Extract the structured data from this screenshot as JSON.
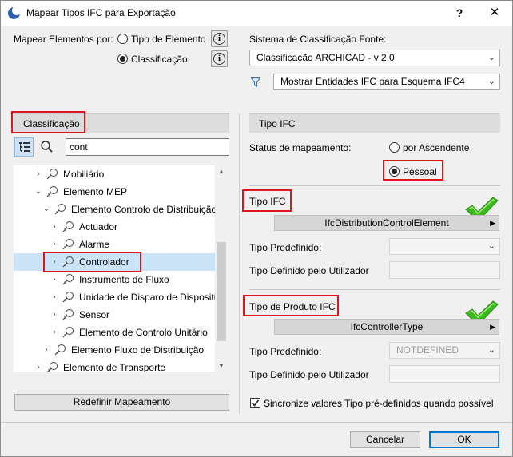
{
  "window": {
    "title": "Mapear Tipos IFC para Exportação",
    "help_label": "?",
    "close_label": "✕"
  },
  "map_by": {
    "label": "Mapear Elementos por:",
    "option_element_type": "Tipo de Elemento",
    "option_classification": "Classificação",
    "selected": "Classificação"
  },
  "source_system": {
    "label": "Sistema de Classificação Fonte:",
    "value": "Classificação ARCHICAD - v 2.0"
  },
  "filter": {
    "icon": "filter-icon",
    "value": "Mostrar Entidades IFC para Esquema IFC4"
  },
  "left_panel": {
    "header": "Classificação",
    "search_value": "cont",
    "tree": [
      {
        "label": "Mobiliário",
        "expander": "›"
      },
      {
        "label": "Elemento MEP",
        "expander": "⌄"
      },
      {
        "label": "Elemento Controlo de Distribuição",
        "expander": "⌄"
      },
      {
        "label": "Actuador",
        "expander": "›"
      },
      {
        "label": "Alarme",
        "expander": "›"
      },
      {
        "label": "Controlador",
        "expander": "›"
      },
      {
        "label": "Instrumento de Fluxo",
        "expander": "›"
      },
      {
        "label": "Unidade de Disparo de Dispositivo",
        "expander": "›"
      },
      {
        "label": "Sensor",
        "expander": "›"
      },
      {
        "label": "Elemento de Controlo Unitário",
        "expander": "›"
      },
      {
        "label": "Elemento Fluxo de Distribuição",
        "expander": "›"
      },
      {
        "label": "Elemento de Transporte",
        "expander": "›"
      }
    ],
    "reset_button": "Redefinir Mapeamento"
  },
  "right_panel": {
    "header": "Tipo IFC",
    "mapping_status_label": "Status de mapeamento:",
    "status_option_parent": "por Ascendente",
    "status_option_custom": "Pessoal",
    "status_selected": "Pessoal",
    "ifc_type": {
      "heading": "Tipo IFC",
      "value": "IfcDistributionControlElement",
      "predefined_label": "Tipo Predefinido:",
      "predefined_value": "",
      "user_defined_label": "Tipo Definido pelo Utilizador"
    },
    "product_type": {
      "heading": "Tipo de Produto IFC",
      "value": "IfcControllerType",
      "predefined_label": "Tipo Predefinido:",
      "predefined_value": "NOTDEFINED",
      "user_defined_label": "Tipo Definido pelo Utilizador"
    },
    "sync_checkbox_label": "Sincronize valores Tipo pré-definidos quando possível",
    "sync_checked": true
  },
  "footer": {
    "cancel": "Cancelar",
    "ok": "OK"
  },
  "colors": {
    "highlight_border": "#e0141e",
    "selection": "#cce4f7",
    "check_green": "#3cb81e"
  }
}
